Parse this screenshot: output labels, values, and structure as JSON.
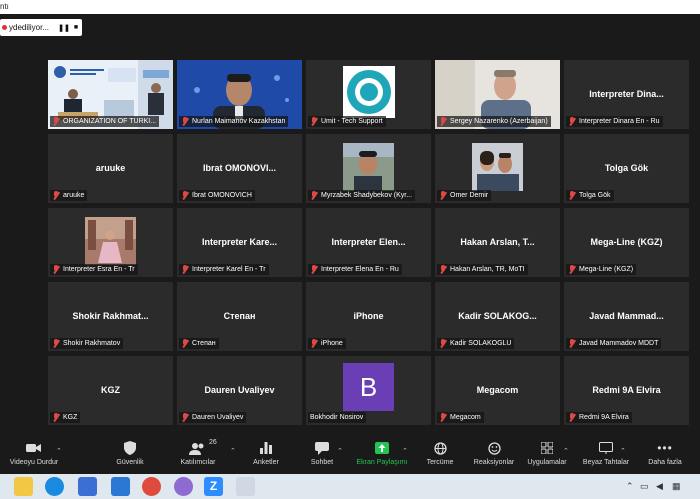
{
  "window": {
    "title_fragment": "ntı"
  },
  "recording": {
    "status_text": "ydediliyor..."
  },
  "tiles": [
    {
      "name": "ORGANIZATION OF TURKI...",
      "center": ""
    },
    {
      "name": "Nurlan Maimanov Kazakhstan",
      "center": ""
    },
    {
      "name": "Umit - Tech Support",
      "center": ""
    },
    {
      "name": "Sergey Nazarenko (Azerbaijan)",
      "center": ""
    },
    {
      "name": "Interpreter Dinara En - Ru",
      "center": "Interpreter Dina..."
    },
    {
      "name": "aruuke",
      "center": "aruuke"
    },
    {
      "name": "Ibrat OMONOVICH",
      "center": "Ibrat OMONOVI..."
    },
    {
      "name": "Myrzabek Shadybekov (Kyr...",
      "center": ""
    },
    {
      "name": "Omer Demir",
      "center": ""
    },
    {
      "name": "Tolga Gök",
      "center": "Tolga Gök"
    },
    {
      "name": "Interpreter Esra En - Tr",
      "center": ""
    },
    {
      "name": "Interpreter Karel En - Tr",
      "center": "Interpreter Kare..."
    },
    {
      "name": "Interpreter Elena En - Ru",
      "center": "Interpreter Elen..."
    },
    {
      "name": "Hakan Arslan, TR, MoTI",
      "center": "Hakan Arslan, T..."
    },
    {
      "name": "Mega-Line (KGZ)",
      "center": "Mega-Line (KGZ)"
    },
    {
      "name": "Shokir Rakhmatov",
      "center": "Shokir Rakhmat..."
    },
    {
      "name": "Степан",
      "center": "Степан"
    },
    {
      "name": "iPhone",
      "center": "iPhone"
    },
    {
      "name": "Kadir SOLAKOGLU",
      "center": "Kadir SOLAKOG..."
    },
    {
      "name": "Javad Mammadov MDDT",
      "center": "Javad Mammad..."
    },
    {
      "name": "KGZ",
      "center": "KGZ"
    },
    {
      "name": "Dauren Uvaliyev",
      "center": "Dauren Uvaliyev"
    },
    {
      "name": "Bokhodir Nosirov",
      "center": ""
    },
    {
      "name": "Megacom",
      "center": "Megacom"
    },
    {
      "name": "Redmi 9A Elvira",
      "center": "Redmi 9A Elvira"
    }
  ],
  "avatar_letter": "B",
  "avatar_color": "#6a3fb5",
  "toolbar": {
    "video": "Videoyu Durdur",
    "security": "Güvenlik",
    "participants": "Katılımcılar",
    "participants_count": "26",
    "polls": "Anketler",
    "chat": "Sohbet",
    "share": "Ekran Paylaşımı",
    "translate": "Tercüme",
    "reactions": "Reaksiyonlar",
    "apps": "Uygulamalar",
    "whiteboards": "Beyaz Tahtalar",
    "more": "Daha fazla"
  },
  "colors": {
    "share_green": "#23c552",
    "active_speaker": "#e8e27a",
    "muted_red": "#e04848"
  }
}
